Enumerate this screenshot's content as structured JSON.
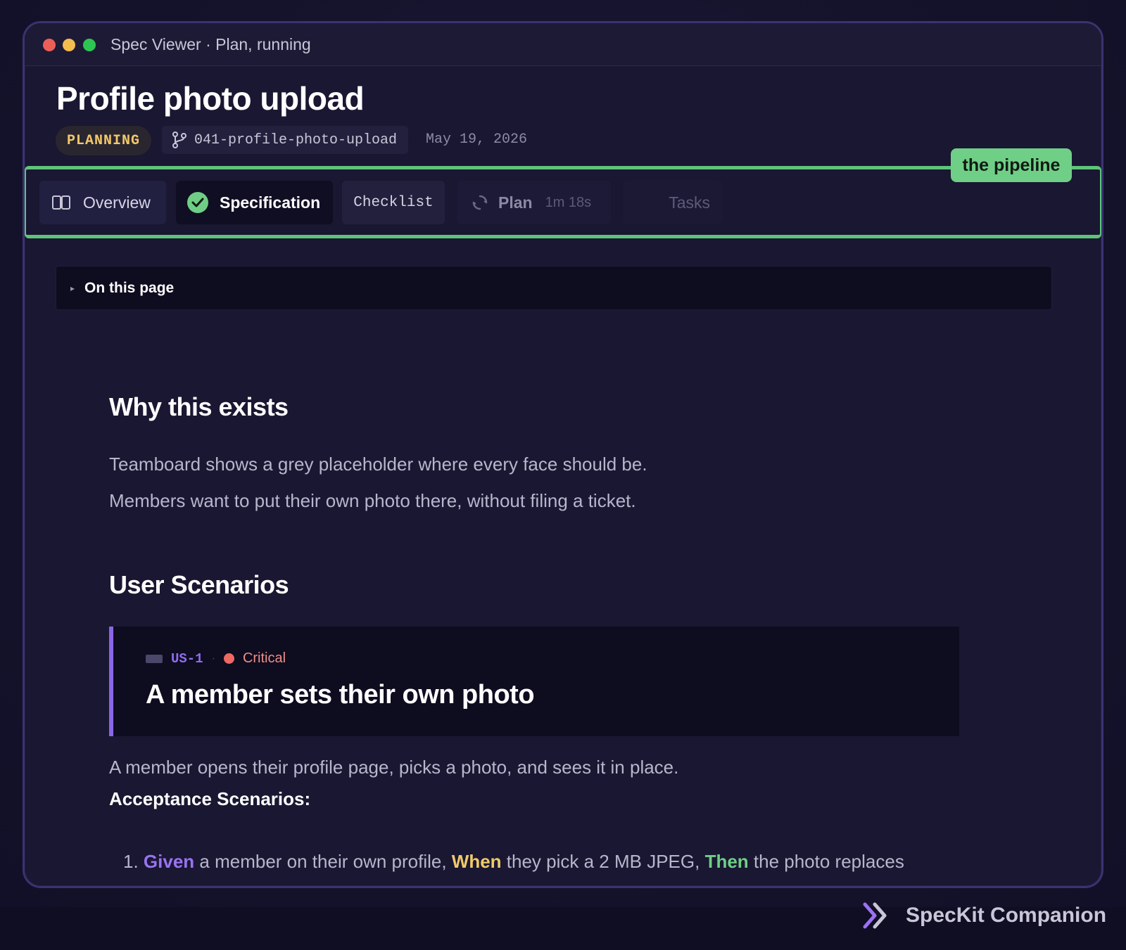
{
  "window": {
    "title": "Spec Viewer · Plan, running"
  },
  "header": {
    "title": "Profile photo upload",
    "status": "PLANNING",
    "branch": "041-profile-photo-upload",
    "date": "May 19, 2026"
  },
  "pipeline": {
    "label": "the pipeline",
    "tabs": {
      "overview": {
        "label": "Overview",
        "icon": "book-icon"
      },
      "specification": {
        "label": "Specification",
        "icon": "check-circle-icon",
        "state": "done"
      },
      "checklist": {
        "label": "Checklist"
      },
      "plan": {
        "label": "Plan",
        "time": "1m 18s",
        "icon": "spinner-icon",
        "state": "running"
      },
      "tasks": {
        "label": "Tasks",
        "state": "pending"
      }
    }
  },
  "toc": {
    "label": "On this page"
  },
  "content": {
    "why_heading": "Why this exists",
    "why_lines": [
      "Teamboard shows a grey placeholder where every face should be.",
      "Members want to put their own photo there, without filing a ticket."
    ],
    "scenarios_heading": "User Scenarios",
    "story": {
      "id": "US-1",
      "priority": "Critical",
      "title": "A member sets their own photo",
      "description": "A member opens their profile page, picks a photo, and sees it in place."
    },
    "acceptance_heading": "Acceptance Scenarios:",
    "acceptance": [
      {
        "number": "1.",
        "given_kw": "Given",
        "given_text": " a member on their own profile, ",
        "when_kw": "When",
        "when_text": " they pick a 2 MB JPEG, ",
        "then_kw": "Then",
        "then_text": " the photo replaces"
      }
    ]
  },
  "brand": {
    "name": "SpecKit Companion"
  },
  "colors": {
    "accent_purple": "#8a66e8",
    "pipeline_green": "#5fc47a",
    "planning_yellow": "#f2c86a",
    "critical_red": "#ec6a63"
  }
}
